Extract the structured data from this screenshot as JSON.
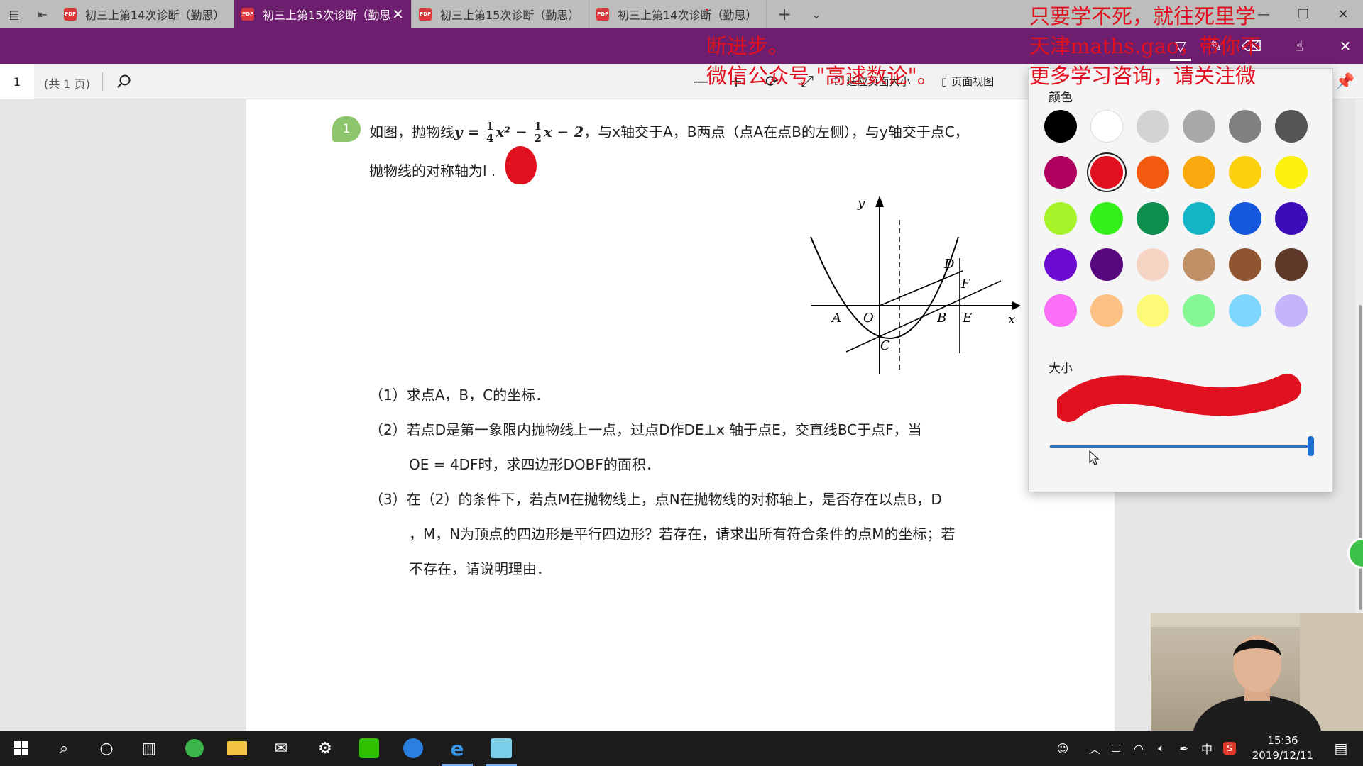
{
  "tabs": [
    {
      "label": "初三上第14次诊断（勤思）",
      "active": false
    },
    {
      "label": "初三上第15次诊断（勤思",
      "active": true
    },
    {
      "label": "初三上第15次诊断（勤思）",
      "active": false
    },
    {
      "label": "初三上第14次诊断（勤思）",
      "active": false
    }
  ],
  "tab_close": "✕",
  "tab_plus": "+",
  "tab_dropdown": "⌄",
  "pdf_badge": "PDF",
  "toolbar": {
    "page_number": "1",
    "page_count": "(共 1 页)",
    "zoom_out": "—",
    "zoom_in": "+",
    "fit_page": "适应页面大小",
    "page_view": "页面视图"
  },
  "document": {
    "question_number": "1",
    "q_line1_pre": "如图，抛物线",
    "q_y": "y = ",
    "frac1": {
      "num": "1",
      "den": "4"
    },
    "q_x2": "x² − ",
    "frac2": {
      "num": "1",
      "den": "2"
    },
    "q_x_minus_2": "x − 2",
    "q_line1_post": "，与x轴交于A，B两点（点A在点B的左侧），与y轴交于点C，",
    "q_line2": "抛物线的对称轴为l .",
    "sub1": "（1）求点A，B，C的坐标．",
    "sub2_line1": "（2）若点D是第一象限内抛物线上一点，过点D作DE⊥x 轴于点E，交直线BC于点F，当",
    "sub2_line2": "OE = 4DF时，求四边形DOBF的面积．",
    "sub3_line1": "（3）在（2）的条件下，若点M在抛物线上，点N在抛物线的对称轴上，是否存在以点B，D",
    "sub3_line2": "，M，N为顶点的四边形是平行四边形？若存在，请求出所有符合条件的点M的坐标；若",
    "sub3_line3": "不存在，请说明理由．"
  },
  "graph_labels": {
    "y": "y",
    "x": "x",
    "A": "A",
    "O": "O",
    "B": "B",
    "E": "E",
    "C": "C",
    "D": "D",
    "F": "F"
  },
  "color_picker": {
    "title": "颜色",
    "size_label": "大小",
    "size_value": 1.0,
    "selected_color": "#e0101e",
    "colors": [
      "#000000",
      "#ffffff",
      "#d3d3d3",
      "#a9a9a9",
      "#808080",
      "#555555",
      "#b0005f",
      "#e0101e",
      "#f25b0f",
      "#f9a80d",
      "#fbd00e",
      "#fbf00e",
      "#a6f22b",
      "#33f01a",
      "#0d8f4f",
      "#13b6c6",
      "#1456dc",
      "#3d0bb8",
      "#6b0bd0",
      "#58077e",
      "#f5d4c3",
      "#c09066",
      "#8e5530",
      "#5e3929",
      "#fb6ef6",
      "#fcc182",
      "#fdfa7a",
      "#86f795",
      "#7fd6fd",
      "#c5b4fb"
    ]
  },
  "annotation": {
    "line1": "只要学不死，就往死里学",
    "line2": "天津maths.gao，带你不",
    "line3": "更多学习咨询，请关注微",
    "line4": "断进步。",
    "line5": "微信公众号 \"高逑数论\"。"
  },
  "taskbar": {
    "time": "15:36",
    "date": "2019/12/11",
    "ime": "中"
  }
}
